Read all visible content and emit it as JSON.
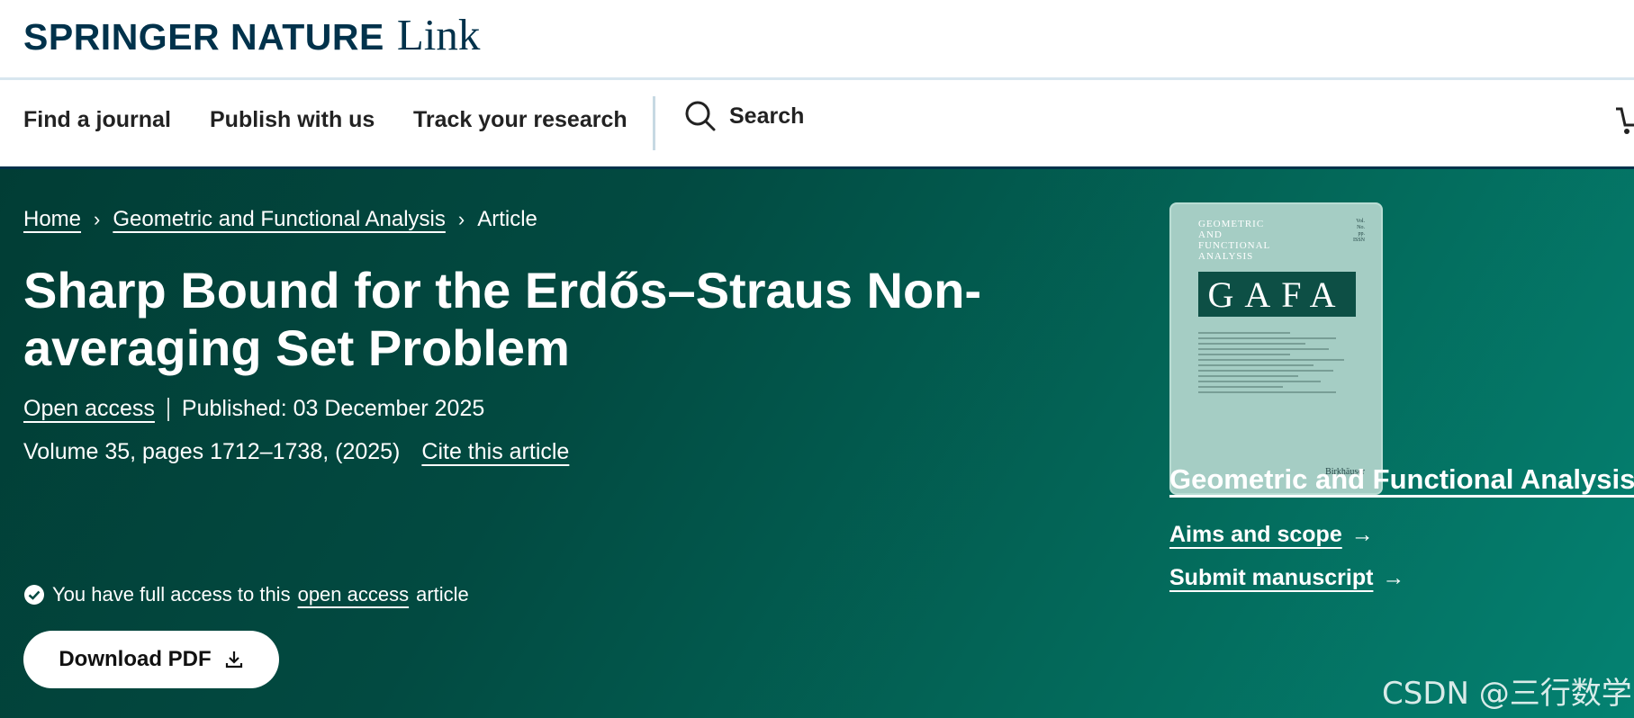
{
  "brand": {
    "name": "SPRINGER NATURE",
    "product": "Link"
  },
  "nav": {
    "items": [
      "Find a journal",
      "Publish with us",
      "Track your research"
    ],
    "search_label": "Search"
  },
  "breadcrumb": {
    "home": "Home",
    "journal": "Geometric and Functional Analysis",
    "current": "Article"
  },
  "article": {
    "title": "Sharp Bound for the Erdős–Straus Non-averaging Set Problem",
    "open_access": "Open access",
    "published": "Published: 03 December 2025",
    "volume": "Volume 35, pages 1712–1738, (2025)",
    "cite": "Cite this article"
  },
  "access": {
    "prefix": "You have full access to this",
    "link": "open access",
    "suffix": "article"
  },
  "download_button": "Download PDF",
  "cover": {
    "title_lines": [
      "GEOMETRIC",
      "AND",
      "FUNCTIONAL",
      "ANALYSIS"
    ],
    "abbrev": "GAFA",
    "publisher": "Birkhäuser"
  },
  "sidebar": {
    "journal_title": "Geometric and Functional Analysis",
    "aims": "Aims and scope",
    "submit": "Submit manuscript"
  },
  "watermark": "CSDN @三行数学",
  "colors": {
    "brand_navy": "#01324b",
    "hero_dark": "#013d35",
    "hero_light": "#048272"
  }
}
